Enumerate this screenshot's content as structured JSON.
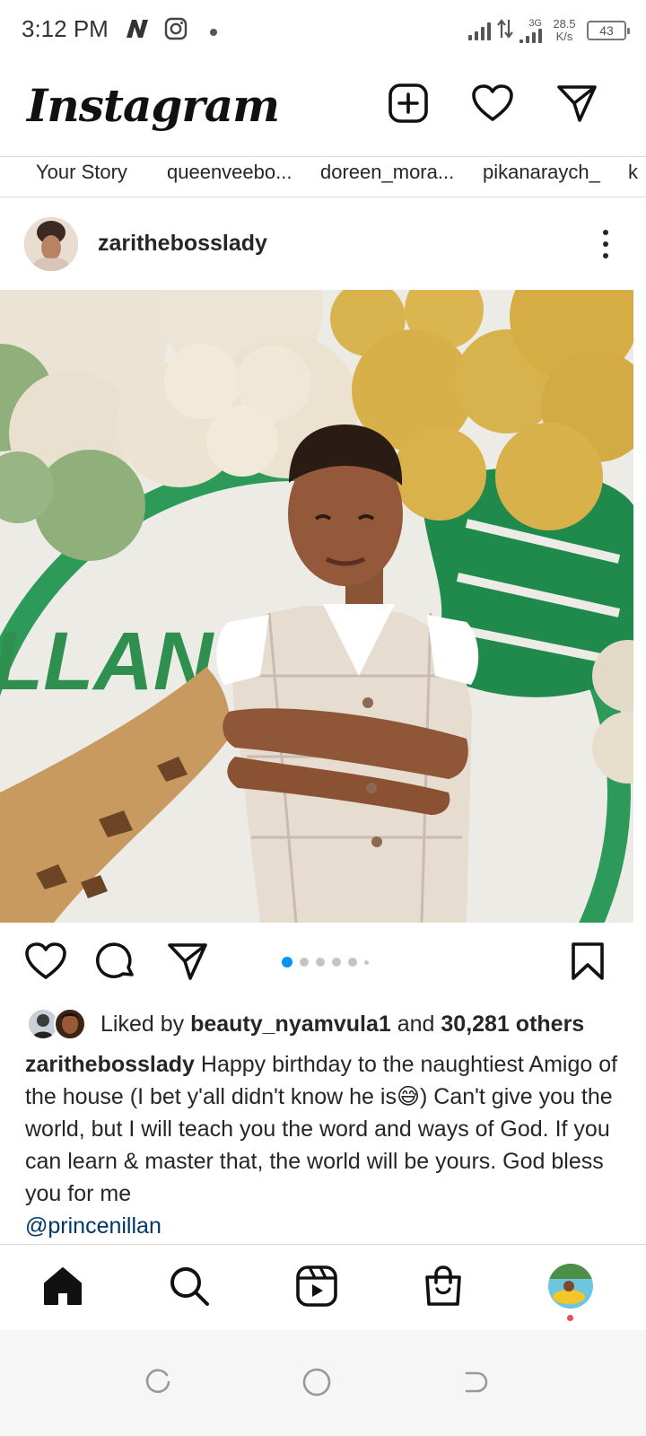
{
  "status_bar": {
    "time": "3:12 PM",
    "network_type": "3G",
    "speed_value": "28.5",
    "speed_unit": "K/s",
    "battery": "43",
    "icons": [
      "n-app-icon",
      "instagram-icon",
      "notification-dot",
      "signal-icon",
      "data-arrows-icon",
      "signal-3g-icon",
      "battery-icon"
    ]
  },
  "app_bar": {
    "logo": "Instagram",
    "icons": [
      "new-post-icon",
      "heart-icon",
      "direct-message-icon"
    ]
  },
  "stories": {
    "labels": [
      "Your Story",
      "queenveebo...",
      "doreen_mora...",
      "pikanaraych_",
      "k"
    ]
  },
  "post": {
    "username": "zarithebosslady",
    "image_text": "LLAN TI",
    "carousel": {
      "count": 6,
      "active_index": 0
    },
    "likes": {
      "prefix": "Liked by ",
      "user": "beauty_nyamvula1",
      "middle": " and ",
      "count": "30,281 others"
    },
    "caption": {
      "username": "zarithebosslady",
      "text": " Happy birthday to the naughtiest Amigo of the house (I bet y'all didn't know he is😅) Can't give you the world, but I will teach you the word and ways of God. If you can learn & master that, the world will be yours. God bless you for me",
      "mention": "@princenillan"
    }
  },
  "bottom_nav": {
    "items": [
      "home-icon",
      "search-icon",
      "reels-icon",
      "shop-icon",
      "profile-avatar"
    ]
  },
  "system_nav": {
    "items": [
      "recents-button",
      "home-button",
      "back-button"
    ]
  },
  "colors": {
    "text": "#262626",
    "divider": "#dbdbdb",
    "accent_blue": "#0095f6",
    "mention": "#00376b",
    "notification_red": "#ed4956"
  }
}
